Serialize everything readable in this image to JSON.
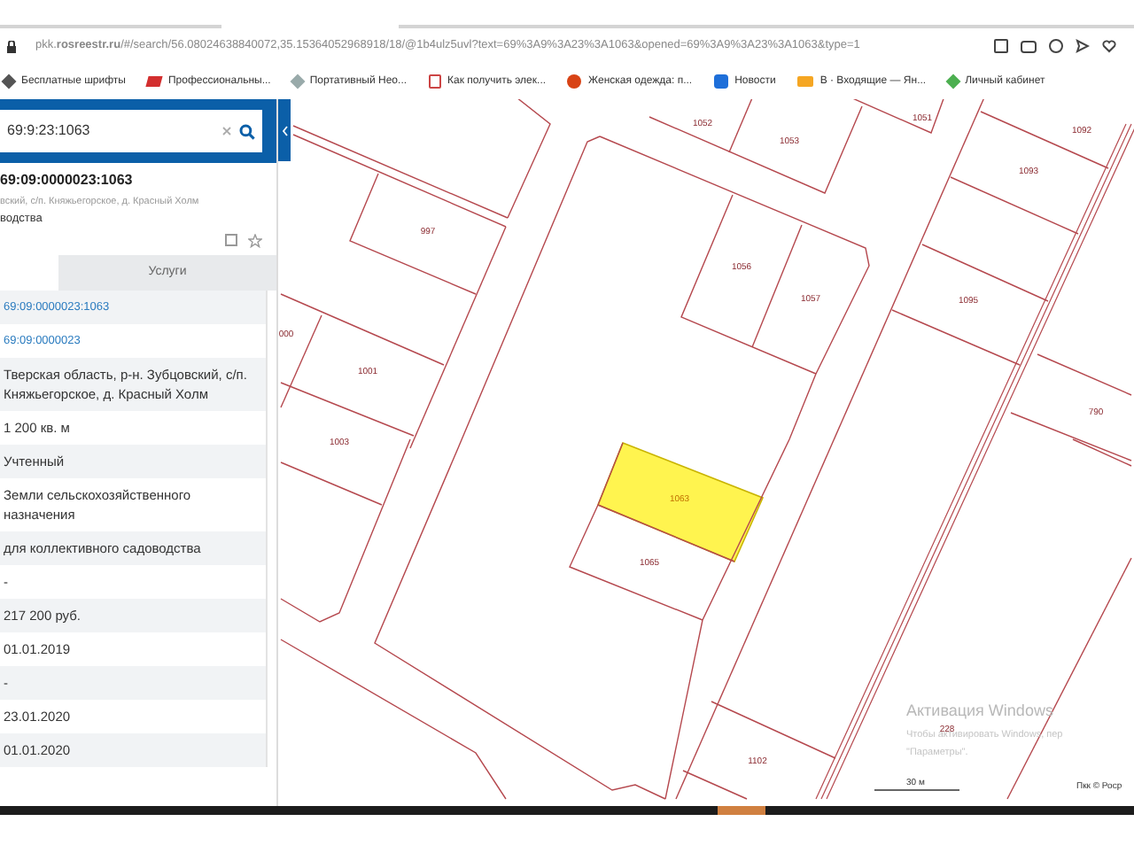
{
  "browser": {
    "url": "pkk.**rosreestr.ru**/#/search/56.08024638840072,35.15364052968918/18/@1b4ulz5uvl?text=69%3A9%3A23%3A1063&opened=69%3A9%3A23%3A1063&type=1",
    "bookmarks": [
      {
        "label": "Бесплатные шрифты"
      },
      {
        "label": "Профессиональны..."
      },
      {
        "label": "Портативный Нео..."
      },
      {
        "label": "Как получить элек..."
      },
      {
        "label": "Женская одежда: п..."
      },
      {
        "label": "Новости"
      },
      {
        "label": "В · Входящие — Ян..."
      },
      {
        "label": "Личный кабинет"
      }
    ]
  },
  "panel": {
    "search": {
      "value": "69:9:23:1063"
    },
    "object": {
      "title": "69:09:0000023:1063",
      "address": "вский, с/п. Княжьегорское, д. Красный Холм",
      "purpose": "водства"
    },
    "tabs": [
      {
        "label": "Услуги",
        "selected": false
      }
    ],
    "rows": [
      {
        "kind": "link",
        "text": "69:09:0000023:1063"
      },
      {
        "kind": "link",
        "text": "69:09:0000023"
      },
      {
        "kind": "text",
        "text": "Тверская область, р-н. Зубцовский, с/п. Княжьегорское, д. Красный Холм"
      },
      {
        "kind": "text",
        "text": "1 200 кв. м"
      },
      {
        "kind": "text",
        "text": "Учтенный"
      },
      {
        "kind": "text",
        "text": "Земли сельскохозяйственного назначения"
      },
      {
        "kind": "text",
        "text": "для коллективного садоводства"
      },
      {
        "kind": "text",
        "text": "-"
      },
      {
        "kind": "text",
        "text": "217 200 руб."
      },
      {
        "kind": "text",
        "text": "01.01.2019"
      },
      {
        "kind": "text",
        "text": "-"
      },
      {
        "kind": "text",
        "text": "23.01.2020"
      },
      {
        "kind": "text",
        "text": "01.01.2020"
      }
    ]
  },
  "map": {
    "parcels": [
      {
        "number": "1052",
        "selected": false
      },
      {
        "number": "1053",
        "selected": false
      },
      {
        "number": "1051",
        "selected": false
      },
      {
        "number": "1092",
        "selected": false
      },
      {
        "number": "1093",
        "selected": false
      },
      {
        "number": "997",
        "selected": false
      },
      {
        "number": "1056",
        "selected": false
      },
      {
        "number": "1057",
        "selected": false
      },
      {
        "number": "1095",
        "selected": false
      },
      {
        "number": "000",
        "selected": false
      },
      {
        "number": "1001",
        "selected": false
      },
      {
        "number": "1003",
        "selected": false
      },
      {
        "number": "790",
        "selected": false
      },
      {
        "number": "1063",
        "selected": true
      },
      {
        "number": "1065",
        "selected": false
      },
      {
        "number": "228",
        "selected": false
      },
      {
        "number": "1102",
        "selected": false
      }
    ],
    "activation": {
      "title": "Активация Windows",
      "lines": [
        "Чтобы активировать Windows, пер",
        "\"Параметры\"."
      ]
    },
    "scale": "30 м",
    "attribution": "Пкк © Роср"
  }
}
